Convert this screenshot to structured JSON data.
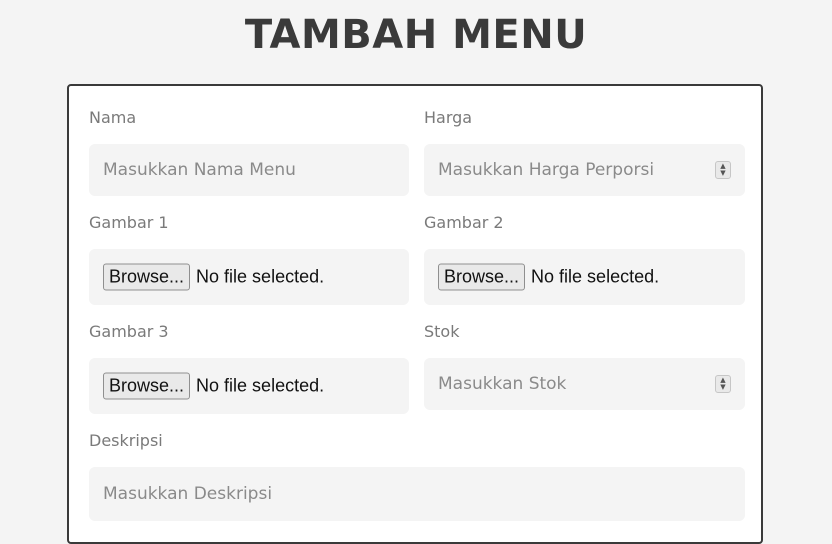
{
  "page": {
    "title": "TAMBAH MENU"
  },
  "form": {
    "nama": {
      "label": "Nama",
      "placeholder": "Masukkan Nama Menu"
    },
    "harga": {
      "label": "Harga",
      "placeholder": "Masukkan Harga Perporsi"
    },
    "gambar1": {
      "label": "Gambar 1",
      "button": "Browse...",
      "status": "No file selected."
    },
    "gambar2": {
      "label": "Gambar 2",
      "button": "Browse...",
      "status": "No file selected."
    },
    "gambar3": {
      "label": "Gambar 3",
      "button": "Browse...",
      "status": "No file selected."
    },
    "stok": {
      "label": "Stok",
      "placeholder": "Masukkan Stok"
    },
    "deskripsi": {
      "label": "Deskripsi",
      "placeholder": "Masukkan Deskripsi"
    }
  },
  "icons": {
    "spinner": "number-spinner-icon"
  },
  "colors": {
    "background": "#f4f4f4",
    "card": "#ffffff",
    "card_border": "#3a3a3a",
    "field_bg": "#f4f4f4",
    "label": "#7a7a7a",
    "title": "#3a3a3a"
  }
}
